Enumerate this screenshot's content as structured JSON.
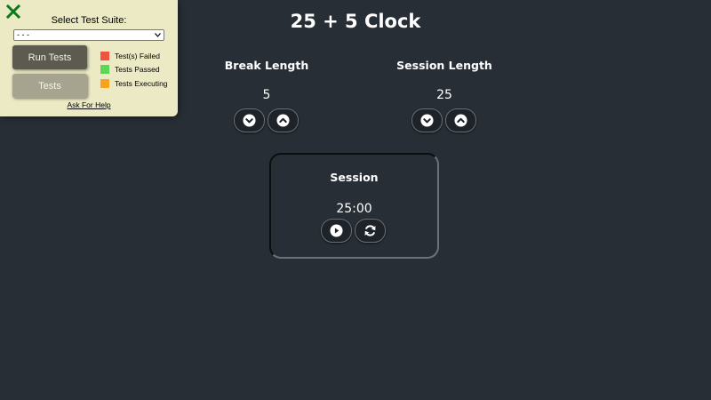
{
  "test_panel": {
    "suite_label": "Select Test Suite:",
    "suite_select_value": "- - -",
    "run_tests_label": "Run Tests",
    "tests_label": "Tests",
    "legend": [
      {
        "label": "Test(s) Failed",
        "color": "#f0533f"
      },
      {
        "label": "Tests Passed",
        "color": "#5ad854"
      },
      {
        "label": "Tests Executing",
        "color": "#f7a31f"
      }
    ],
    "help_link": "Ask For Help",
    "close_icon_color": "#0b7a1d"
  },
  "clock": {
    "title": "25 + 5 Clock",
    "break": {
      "label": "Break Length",
      "value": "5"
    },
    "session": {
      "label": "Session Length",
      "value": "25"
    },
    "timer": {
      "label": "Session",
      "time": "25:00"
    }
  },
  "icons": {
    "decrement": "chevron-down-circle-icon",
    "increment": "chevron-up-circle-icon",
    "start_stop": "play-circle-icon",
    "reset": "refresh-icon"
  }
}
